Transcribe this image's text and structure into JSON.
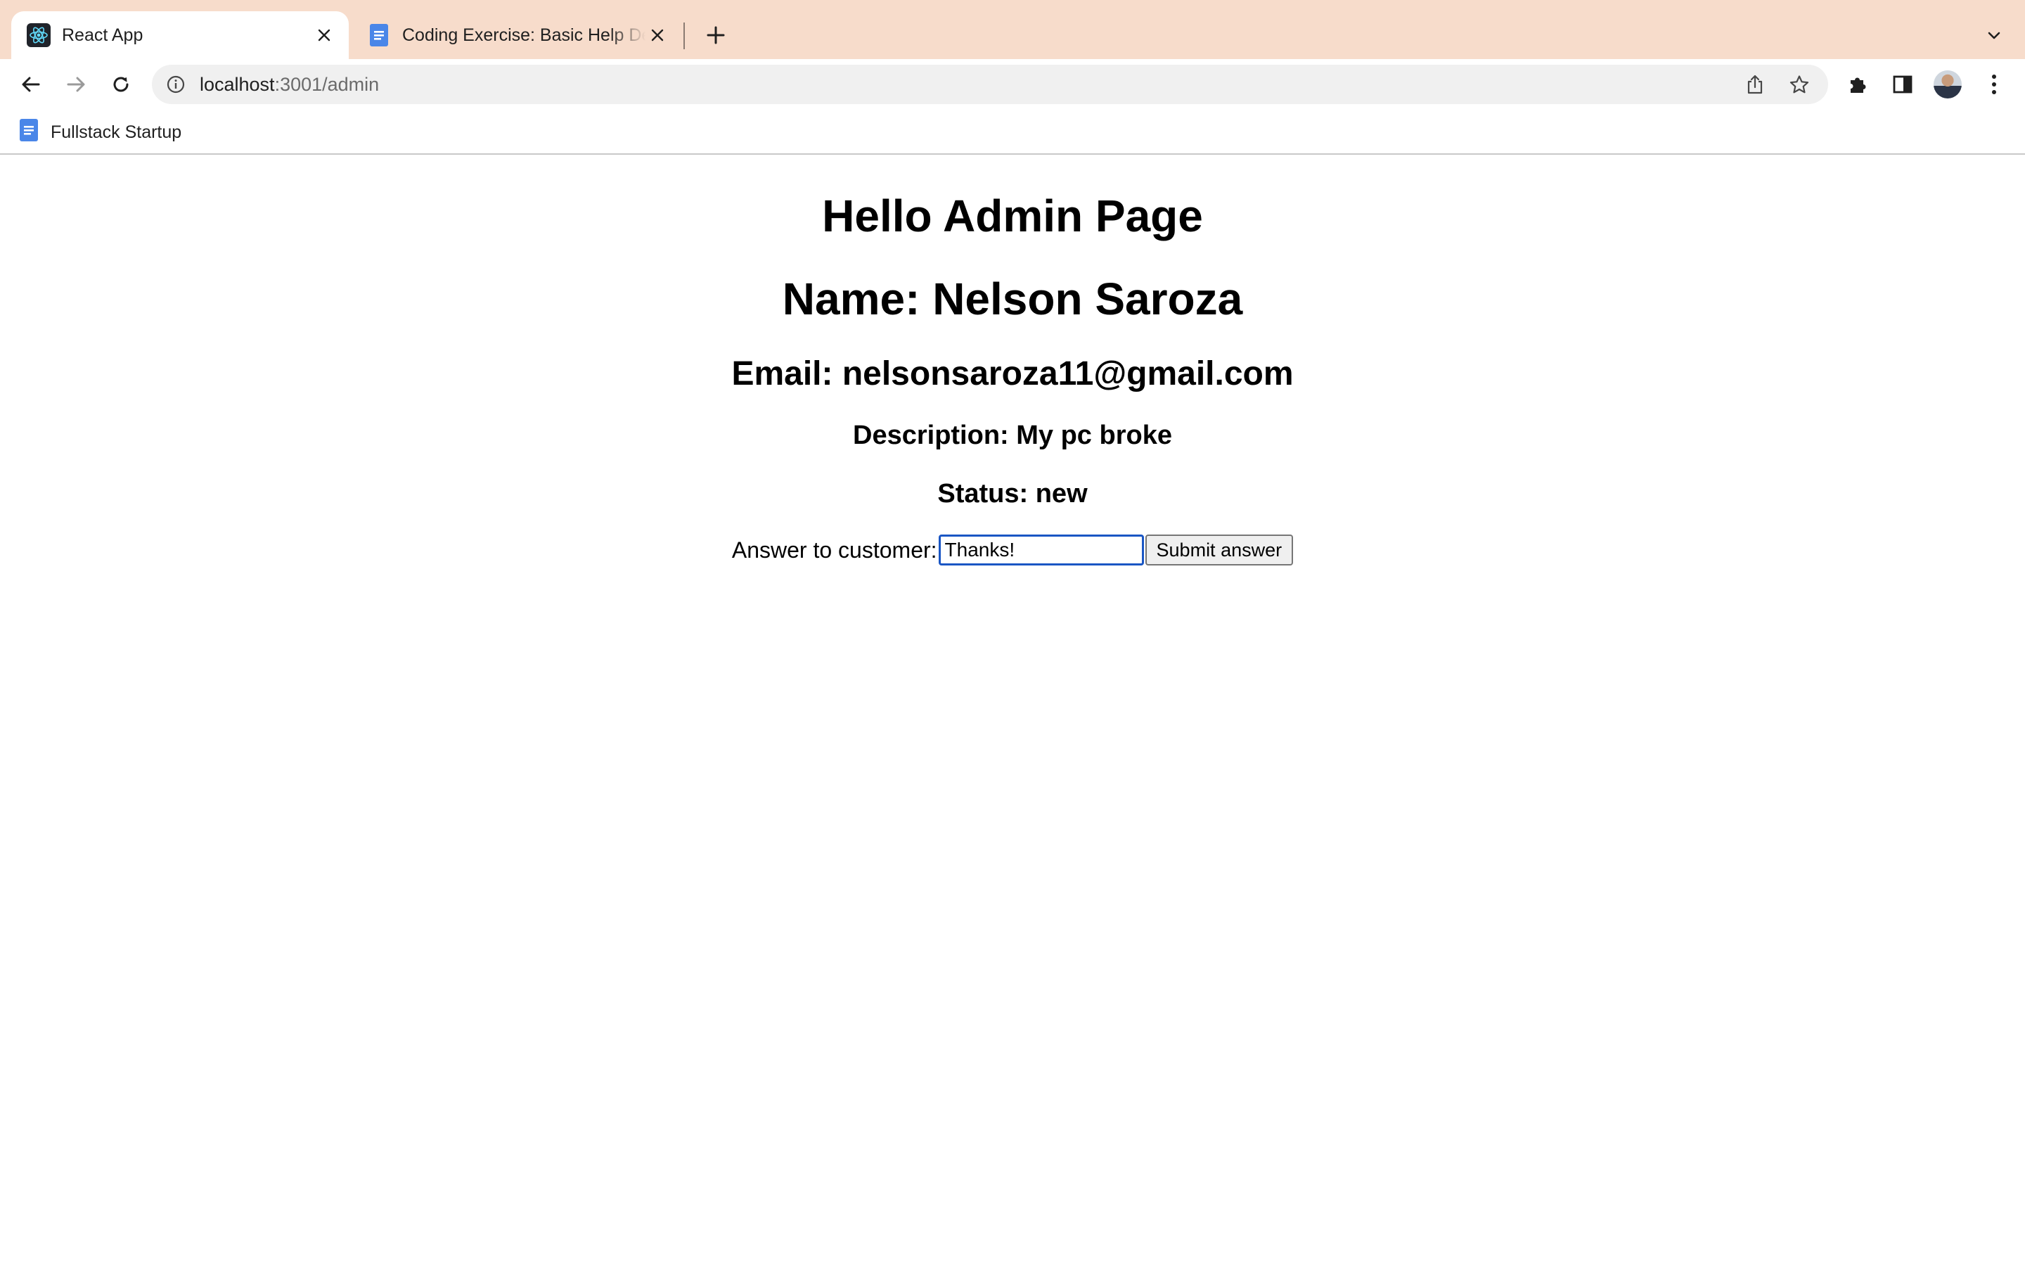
{
  "browser": {
    "tabs": [
      {
        "title": "React App",
        "icon": "react-icon",
        "active": true
      },
      {
        "title": "Coding Exercise: Basic Help Desk",
        "icon": "docs-icon",
        "active": false
      }
    ],
    "address_bar": {
      "host": "localhost",
      "path": ":3001/admin"
    },
    "bookmarks": [
      {
        "label": "Fullstack Startup",
        "icon": "docs-icon"
      }
    ],
    "theme": {
      "tabstrip_color": "#f7dccb",
      "docs_blue": "#4a86e8",
      "focus_color": "#1a56c4"
    }
  },
  "page": {
    "title": "Hello Admin Page",
    "name_line": "Name: Nelson Saroza",
    "email_line": "Email: nelsonsaroza11@gmail.com",
    "description_line": "Description: My pc broke",
    "status_line": "Status: new",
    "answer_label": "Answer to customer:",
    "answer_value": "Thanks!",
    "submit_label": "Submit answer"
  }
}
